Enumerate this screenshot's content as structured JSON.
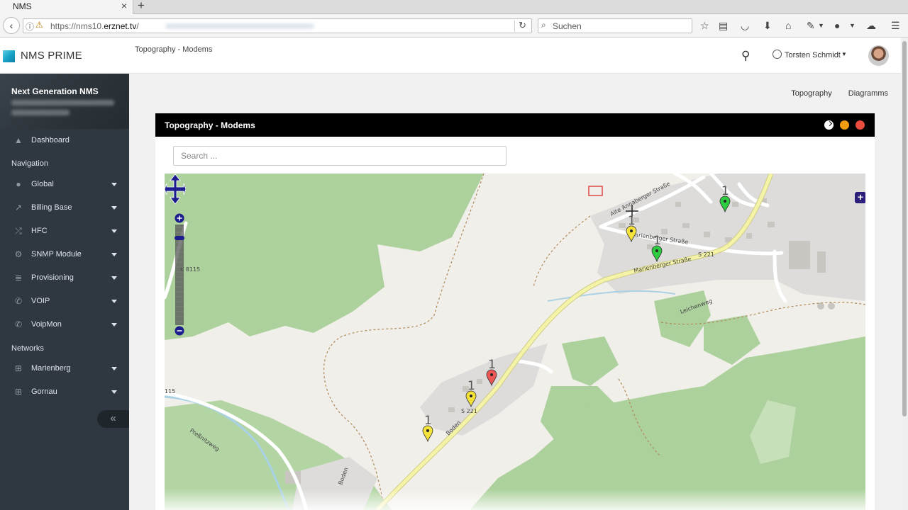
{
  "browser": {
    "tab_title": "NMS",
    "tab_close": "×",
    "new_tab": "+",
    "url_prefix": "https://nms10.",
    "url_domain": "erznet.tv",
    "url_suffix": "/",
    "search_placeholder": "Suchen",
    "back_icon": "‹"
  },
  "app": {
    "brand": "NMS PRIME",
    "header_breadcrumb": "Topography - Modems",
    "user_name": "Torsten Schmidt"
  },
  "sidebar": {
    "title": "Next Generation NMS",
    "dashboard": "Dashboard",
    "section_navigation": "Navigation",
    "nav_items": [
      {
        "label": "Global",
        "icon": "globe-icon"
      },
      {
        "label": "Billing Base",
        "icon": "line-chart-icon"
      },
      {
        "label": "HFC",
        "icon": "random-icon"
      },
      {
        "label": "SNMP Module",
        "icon": "cogs-icon"
      },
      {
        "label": "Provisioning",
        "icon": "database-icon"
      },
      {
        "label": "VOIP",
        "icon": "phone-icon"
      },
      {
        "label": "VoipMon",
        "icon": "phone-icon"
      }
    ],
    "section_networks": "Networks",
    "networks": [
      {
        "label": "Marienberg",
        "icon": "sitemap-icon"
      },
      {
        "label": "Gornau",
        "icon": "sitemap-icon"
      }
    ],
    "collapse_icon": "«"
  },
  "content": {
    "crumb_links": [
      "Topography",
      "Diagramms"
    ],
    "panel_title": "Topography - Modems",
    "search_placeholder": "Search ..."
  },
  "map": {
    "road_labels": {
      "k8115": "K 8115",
      "k115": "115",
      "s221_top": "S 221",
      "s221_bottom": "S 221",
      "alte": "Alte Annaberger Straße",
      "marienberger_upper": "Marienberger Straße",
      "marienberger_lower": "Marienberger Straße",
      "leichenweg": "Leichenweg",
      "boden": "Boden",
      "boden2": "Boden",
      "pressnitz": "Preßnitzweg"
    },
    "markers": [
      {
        "status": "green",
        "count": "1",
        "color": "#2ecc40"
      },
      {
        "status": "yellow",
        "count": "1",
        "color": "#f5e23a"
      },
      {
        "status": "green",
        "count": "1",
        "color": "#2ecc40"
      },
      {
        "status": "red",
        "count": "1",
        "color": "#ee5555"
      },
      {
        "status": "yellow",
        "count": "1",
        "color": "#f5e23a"
      },
      {
        "status": "yellow",
        "count": "1",
        "color": "#f5e23a"
      }
    ],
    "colors": {
      "forest": "#acd19c",
      "land": "#f1efe9",
      "road_main": "#f4f3a8",
      "settlement": "#dddcda"
    }
  }
}
